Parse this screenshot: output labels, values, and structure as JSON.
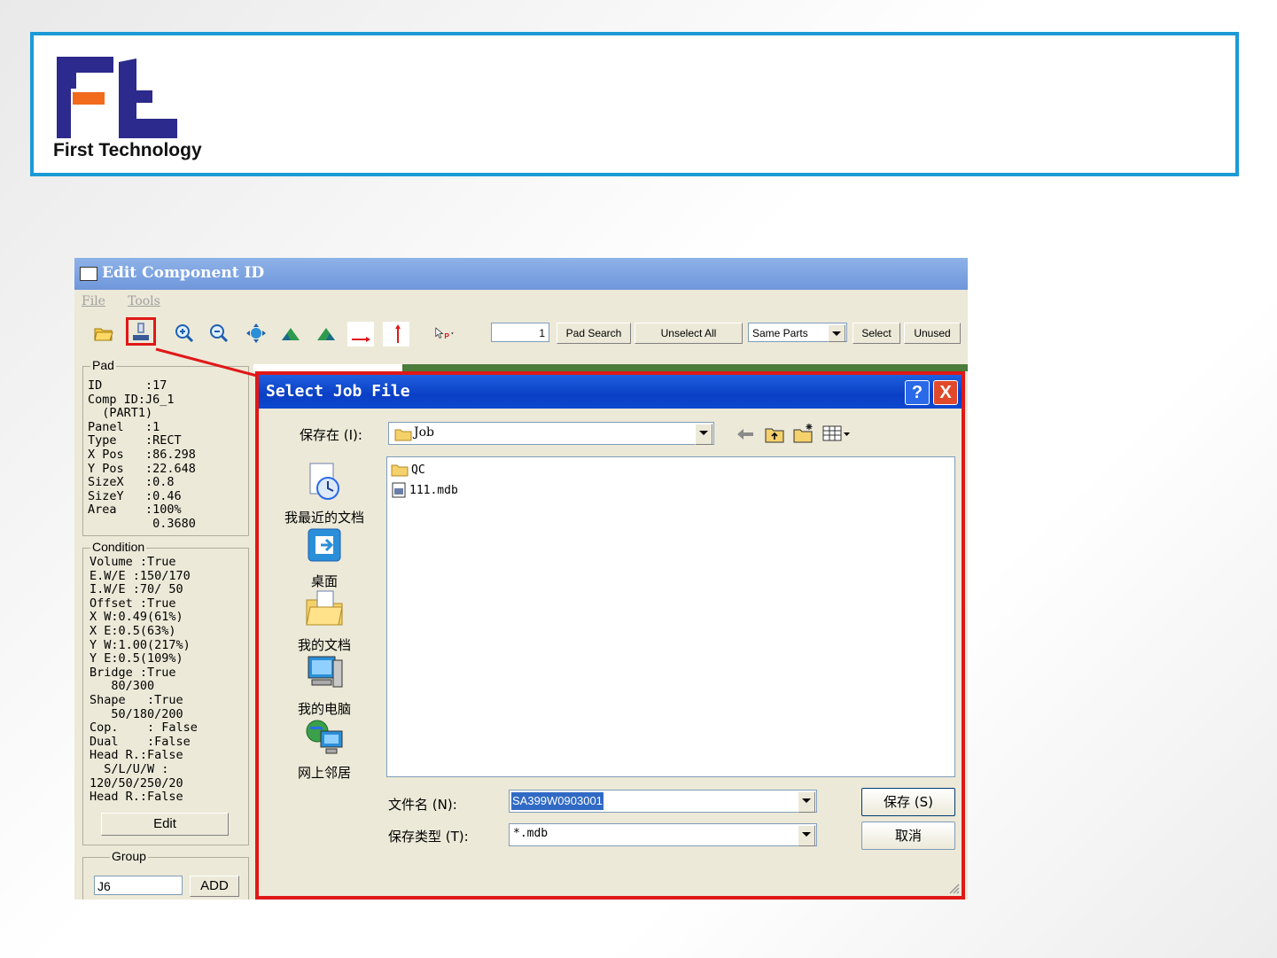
{
  "banner": {
    "company": "First Technology"
  },
  "app": {
    "title": "Edit Component ID",
    "menu": [
      "File",
      "Tools"
    ],
    "toolbar": {
      "pad_input_value": "1",
      "pad_search": "Pad Search",
      "unselect_all": "Unselect All",
      "same_parts": "Same Parts",
      "select": "Select",
      "unused": "Unused"
    },
    "pad": {
      "label": "Pad",
      "lines": [
        "ID      :17",
        "Comp ID:J6_1",
        "  (PART1)",
        "Panel   :1",
        "Type    :RECT",
        "X Pos   :86.298",
        "Y Pos   :22.648",
        "SizeX   :0.8",
        "SizeY   :0.46",
        "Area    :100%",
        "         0.3680"
      ]
    },
    "condition": {
      "label": "Condition",
      "lines": [
        "Volume :True",
        "E.W/E :150/170",
        "I.W/E :70/ 50",
        "Offset :True",
        "X W:0.49(61%)",
        "X E:0.5(63%)",
        "Y W:1.00(217%)",
        "Y E:0.5(109%)",
        "Bridge :True",
        "   80/300",
        "Shape   :True",
        "   50/180/200",
        "Cop.    : False",
        "Dual    :False",
        "Head R.:False",
        "  S/L/U/W :",
        "120/50/250/20",
        "Head R.:False"
      ],
      "edit_button": "Edit"
    },
    "group": {
      "label": "Group",
      "value": "J6",
      "add_button": "ADD"
    }
  },
  "dialog": {
    "title": "Select Job File",
    "help": "?",
    "close": "X",
    "save_in_label": "保存在 (I):",
    "save_in_value": "Job",
    "places": [
      "我最近的文档",
      "桌面",
      "我的文档",
      "我的电脑",
      "网上邻居"
    ],
    "files": [
      "QC",
      "111.mdb"
    ],
    "filename_label": "文件名 (N):",
    "filename_value": "SA399W0903001",
    "filetype_label": "保存类型 (T):",
    "filetype_value": "*.mdb",
    "save_button": "保存 (S)",
    "cancel_button": "取消"
  },
  "colors": {
    "highlight": "#e01818",
    "banner_border": "#1b9ad6",
    "logo_blue": "#2c2a8c",
    "logo_orange": "#f26b1d"
  }
}
